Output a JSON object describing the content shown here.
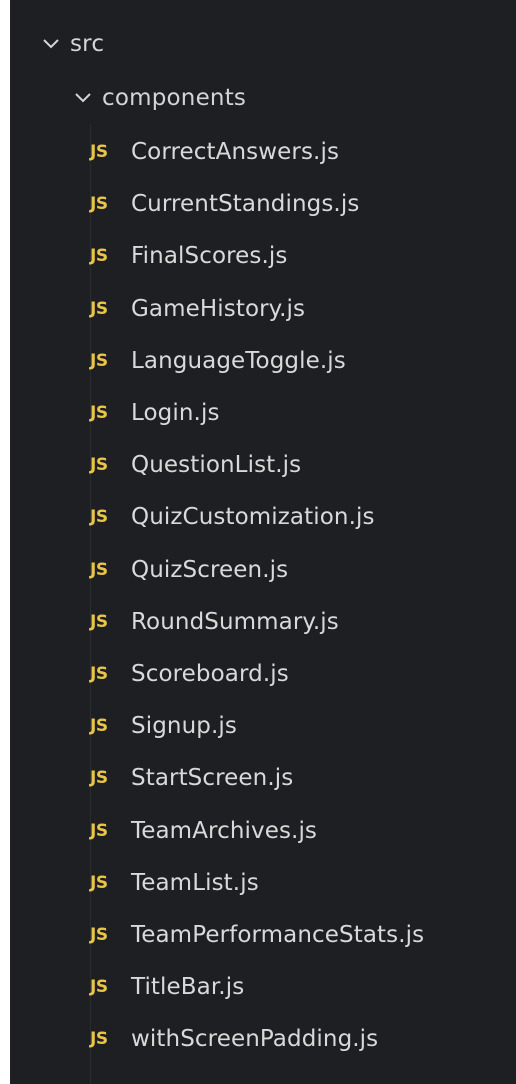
{
  "explorer": {
    "src_folder": {
      "label": "src",
      "icon": "chevron-down-icon",
      "expanded": true
    },
    "components_folder": {
      "label": "components",
      "icon": "chevron-down-icon",
      "expanded": true
    },
    "file_icon_text": "JS",
    "file_icon_color": "#e8c547",
    "files": [
      "CorrectAnswers.js",
      "CurrentStandings.js",
      "FinalScores.js",
      "GameHistory.js",
      "LanguageToggle.js",
      "Login.js",
      "QuestionList.js",
      "QuizCustomization.js",
      "QuizScreen.js",
      "RoundSummary.js",
      "Scoreboard.js",
      "Signup.js",
      "StartScreen.js",
      "TeamArchives.js",
      "TeamList.js",
      "TeamPerformanceStats.js",
      "TitleBar.js",
      "withScreenPadding.js"
    ]
  }
}
